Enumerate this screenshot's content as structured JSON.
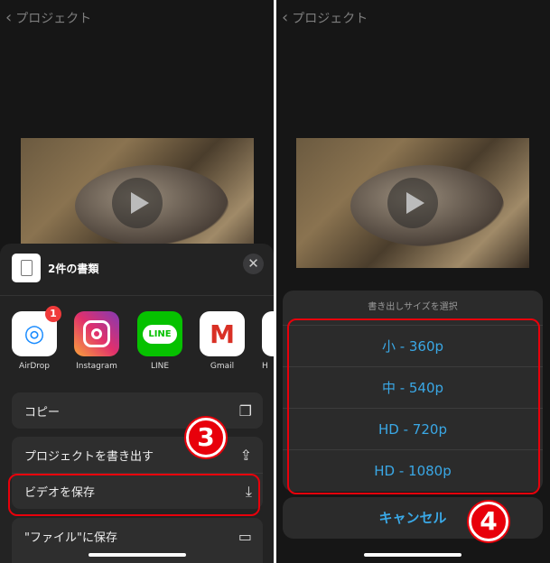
{
  "nav": {
    "back_label": "プロジェクト"
  },
  "share_sheet": {
    "title": "2件の書類",
    "apps": [
      {
        "label": "AirDrop",
        "badge": "1"
      },
      {
        "label": "Instagram"
      },
      {
        "label": "LINE",
        "icon_text": "LINE"
      },
      {
        "label": "Gmail",
        "icon_text": "M"
      },
      {
        "label": "H"
      }
    ],
    "actions": [
      {
        "label": "コピー",
        "icon": "copy-icon"
      },
      {
        "label": "プロジェクトを書き出す",
        "icon": "share-icon"
      },
      {
        "label": "ビデオを保存",
        "icon": "save-icon"
      },
      {
        "label": "\"ファイル\"に保存",
        "icon": "folder-icon"
      }
    ]
  },
  "export_sheet": {
    "title": "書き出しサイズを選択",
    "options": [
      "小 - 360p",
      "中 - 540p",
      "HD - 720p",
      "HD - 1080p"
    ],
    "cancel": "キャンセル"
  },
  "annotations": {
    "step3": "3",
    "step4": "4"
  },
  "colors": {
    "accent": "#3aa8e6",
    "highlight": "#e8000b"
  }
}
